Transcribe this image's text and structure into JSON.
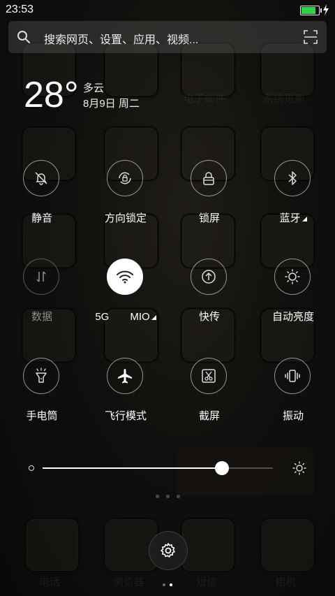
{
  "status_bar": {
    "time": "23:53",
    "battery_level": 0.85,
    "battery_color": "#2fd34a"
  },
  "search": {
    "placeholder": "搜索网页、设置、应用、视频..."
  },
  "weather": {
    "temperature": "28°",
    "condition": "多云",
    "date": "8月9日 周二"
  },
  "toggles": [
    {
      "label": "静音",
      "icon": "bell-off-icon",
      "state": "off"
    },
    {
      "label": "方向锁定",
      "icon": "rotation-lock-icon",
      "state": "off"
    },
    {
      "label": "锁屏",
      "icon": "lock-icon",
      "state": "off"
    },
    {
      "label": "蓝牙",
      "icon": "bluetooth-icon",
      "state": "off"
    },
    {
      "label": "数据",
      "icon": "mobile-data-icon",
      "state": "disabled"
    },
    {
      "label": "5G　　MIO",
      "icon": "wifi-icon",
      "state": "on"
    },
    {
      "label": "快传",
      "icon": "share-upload-icon",
      "state": "off"
    },
    {
      "label": "自动亮度",
      "icon": "brightness-auto-icon",
      "state": "off"
    },
    {
      "label": "手电筒",
      "icon": "flashlight-icon",
      "state": "off"
    },
    {
      "label": "飞行模式",
      "icon": "airplane-icon",
      "state": "off"
    },
    {
      "label": "截屏",
      "icon": "screenshot-icon",
      "state": "off"
    },
    {
      "label": "振动",
      "icon": "vibrate-icon",
      "state": "off"
    }
  ],
  "brightness": {
    "level": 0.78
  },
  "background_apps": {
    "row_labels_bottom": [
      "电话",
      "浏览器",
      "短信",
      "相机"
    ],
    "row_labels_top": [
      "电子邮件",
      "系统更新"
    ]
  },
  "colors": {
    "accent": "#ffffff",
    "shade": "#1f1d19"
  }
}
